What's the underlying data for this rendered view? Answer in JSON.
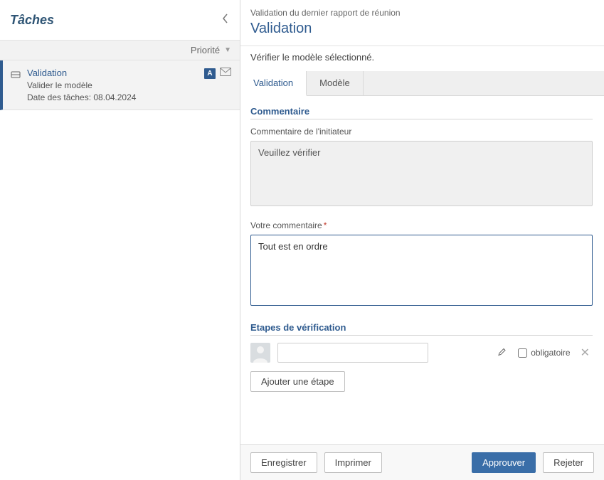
{
  "sidebar": {
    "title": "Tâches",
    "priority_label": "Priorité",
    "task": {
      "title": "Validation",
      "subtitle": "Valider le modèle",
      "date_label": "Date des tâches: 08.04.2024",
      "badge": "A"
    }
  },
  "header": {
    "breadcrumb": "Validation du dernier rapport de réunion",
    "title": "Validation",
    "subtitle": "Vérifier le modèle sélectionné."
  },
  "tabs": {
    "validation": "Validation",
    "modele": "Modèle"
  },
  "form": {
    "section_comment": "Commentaire",
    "initiator_label": "Commentaire de l'initiateur",
    "initiator_value": "Veuillez vérifier",
    "your_comment_label": "Votre commentaire",
    "your_comment_value": "Tout est en ordre",
    "section_steps": "Etapes de vérification",
    "oblig_label": "obligatoire",
    "add_step": "Ajouter une étape"
  },
  "footer": {
    "save": "Enregistrer",
    "print": "Imprimer",
    "approve": "Approuver",
    "reject": "Rejeter"
  }
}
